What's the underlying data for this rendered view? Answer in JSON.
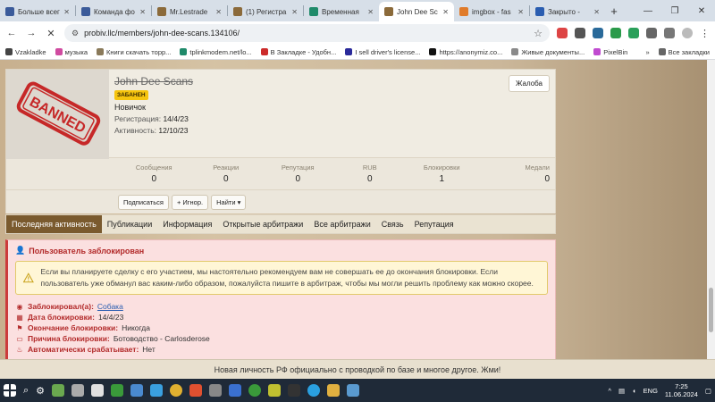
{
  "browser": {
    "tabs": [
      {
        "title": "Больше всег",
        "color": "#3b5b9a"
      },
      {
        "title": "Команда фо",
        "color": "#3b5b9a"
      },
      {
        "title": "Mr.Lestrade",
        "color": "#8b6a3a"
      },
      {
        "title": "(1) Регистра",
        "color": "#8b6a3a"
      },
      {
        "title": "Временная",
        "color": "#1f8a6a"
      },
      {
        "title": "John Dee Sc",
        "color": "#8b6a3a",
        "active": true
      },
      {
        "title": "imgbox - fas",
        "color": "#e07b2a"
      },
      {
        "title": "Закрыто - ",
        "color": "#2a5db0"
      }
    ],
    "new_tab": "+",
    "url": "probiv.llc/members/john-dee-scans.134106/"
  },
  "bookmarks": [
    {
      "label": "Vzakladke",
      "color": "#444"
    },
    {
      "label": "музыка",
      "color": "#d04ba0"
    },
    {
      "label": "Книги скачать торр...",
      "color": "#8a7a5a"
    },
    {
      "label": "tplinkmodem.net/lo...",
      "color": "#1f8a6a"
    },
    {
      "label": "В Закладке - Удобн...",
      "color": "#cc2b2b"
    },
    {
      "label": "I sell driver's license...",
      "color": "#2a2a9a"
    },
    {
      "label": "https://anonymiz.co...",
      "color": "#111"
    },
    {
      "label": "Живые документы...",
      "color": "#8a8a8a"
    },
    {
      "label": "PixelBin",
      "color": "#c04bd0"
    }
  ],
  "bookmarks_all": "Все закладки",
  "profile": {
    "username": "John Dee Scans",
    "badge": "ЗАБАНЕН",
    "rank": "Новичок",
    "registered_label": "Регистрация:",
    "registered": "14/4/23",
    "activity_label": "Активность:",
    "activity": "12/10/23",
    "report_button": "Жалоба",
    "stamp_text": "BANNED"
  },
  "stats": [
    {
      "label": "Сообщения",
      "value": "0"
    },
    {
      "label": "Реакции",
      "value": "0"
    },
    {
      "label": "Репутация",
      "value": "0"
    },
    {
      "label": "RUB",
      "value": "0"
    },
    {
      "label": "Блокировки",
      "value": "1"
    },
    {
      "label": "Медали",
      "value": "0"
    }
  ],
  "actions": {
    "subscribe": "Подписаться",
    "ignore": "+ Игнор.",
    "find": "Найти ▾"
  },
  "profile_tabs": [
    {
      "label": "Последняя активность",
      "active": true
    },
    {
      "label": "Публикации"
    },
    {
      "label": "Информация"
    },
    {
      "label": "Открытые арбитражи"
    },
    {
      "label": "Все арбитражи"
    },
    {
      "label": "Связь"
    },
    {
      "label": "Репутация"
    }
  ],
  "ban": {
    "title": "Пользователь заблокирован",
    "notice": "Если вы планируете сделку с его участием, мы настоятельно рекомендуем вам не совершать ее до окончания блокировки. Если пользователь уже обманул вас каким-либо образом, пожалуйста пишите в арбитраж, чтобы мы могли решить проблему как можно скорее.",
    "rows": [
      {
        "key": "Заблокировал(а):",
        "value": "Собака",
        "link": true,
        "icon": "user-icon"
      },
      {
        "key": "Дата блокировки:",
        "value": "14/4/23",
        "icon": "calendar-icon"
      },
      {
        "key": "Окончание блокировки:",
        "value": "Никогда",
        "icon": "flag-icon"
      },
      {
        "key": "Причина блокировки:",
        "value": "Ботоводство - Carlosderose",
        "icon": "comment-icon"
      },
      {
        "key": "Автоматически срабатывает:",
        "value": "Нет",
        "icon": "fire-icon"
      }
    ]
  },
  "noticebar": "Новая личность РФ официально с проводкой по базе и многое другое. Жми!",
  "taskbar": {
    "lang": "ENG",
    "time": "7:25",
    "date": "11.06.2024"
  },
  "colors": {
    "accent_tab": "#7a5a2e",
    "ban_red": "#b22a2a",
    "badge_yellow": "#f6c40e"
  }
}
